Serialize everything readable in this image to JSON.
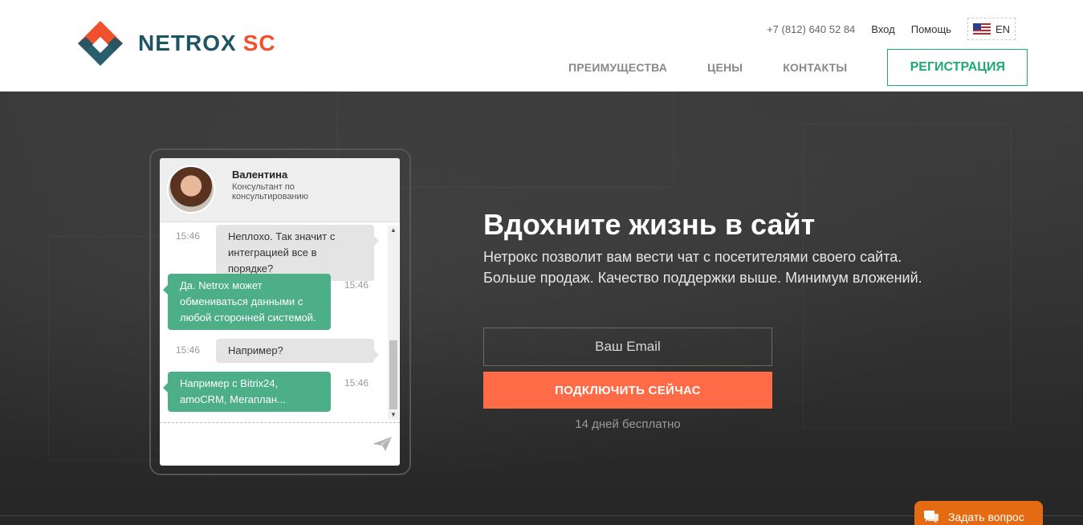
{
  "brand": {
    "name_part1": "NETROX",
    "name_part2": "SC"
  },
  "top_bar": {
    "phone": "+7 (812) 640 52 84",
    "login": "Вход",
    "help": "Помощь",
    "lang": "EN"
  },
  "nav": {
    "items": [
      "ПРЕИМУЩЕСТВА",
      "ЦЕНЫ",
      "КОНТАКТЫ"
    ],
    "register": "РЕГИСТРАЦИЯ"
  },
  "chat": {
    "agent_name": "Валентина",
    "agent_role": "Консультант по консультированию",
    "messages": [
      {
        "from": "visitor",
        "time": "15:46",
        "text": "Неплохо. Так значит с интеграцией все в порядке?"
      },
      {
        "from": "agent",
        "time": "15:46",
        "text": "Да. Netrox может обмениваться данными с любой сторонней системой."
      },
      {
        "from": "visitor",
        "time": "15:46",
        "text": "Например?"
      },
      {
        "from": "agent",
        "time": "15:46",
        "text": "Например с Bitrix24, amoCRM, Мегаплан..."
      }
    ]
  },
  "hero": {
    "title": "Вдохните жизнь в сайт",
    "subtitle_line1": "Нетрокс позволит вам вести чат с посетителями своего сайта.",
    "subtitle_line2": "Больше продаж. Качество поддержки выше. Минимум вложений.",
    "email_placeholder": "Ваш Email",
    "cta": "ПОДКЛЮЧИТЬ СЕЙЧАС",
    "note": "14 дней бесплатно"
  },
  "ask_widget": {
    "label": "Задать вопрос"
  },
  "colors": {
    "brand_dark": "#1e5565",
    "brand_accent": "#f0502c",
    "green": "#1faa72",
    "cta": "#ff6a47",
    "ask": "#e46b12"
  }
}
